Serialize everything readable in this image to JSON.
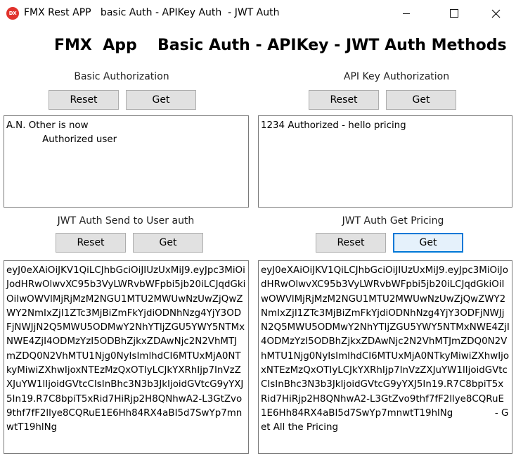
{
  "window": {
    "icon_text": "DX",
    "title": "FMX Rest APP   basic Auth - APIKey Auth  - JWT Auth"
  },
  "header": {
    "left": "FMX  App",
    "right": "Basic Auth - APIKey - JWT Auth Methods"
  },
  "basic_auth": {
    "label": "Basic Authorization",
    "reset_label": "Reset",
    "get_label": "Get",
    "memo": "A.N. Other is now\n            Authorized user"
  },
  "api_key": {
    "label": "API Key Authorization",
    "reset_label": "Reset",
    "get_label": "Get",
    "memo": "1234 Authorized - hello pricing"
  },
  "jwt_user": {
    "label": "JWT Auth Send to User auth",
    "reset_label": "Reset",
    "get_label": "Get",
    "memo": "eyJ0eXAiOiJKV1QiLCJhbGciOiJIUzUxMiJ9.eyJpc3MiOiJodHRwOlwvXC95b3VyLWRvbWFpbi5jb20iLCJqdGkiOiIwOWVlMjRjMzM2NGU1MTU2MWUwNzUwZjQwZWY2NmIxZjI1ZTc3MjBiZmFkYjdiODNhNzg4YjY3ODFjNWJjN2Q5MWU5ODMwY2NhYTljZGU5YWY5NTMxNWE4ZjI4ODMzYzI5ODBhZjkxZDAwNjc2N2VhMTJmZDQ0N2VhMTU1Njg0NyIsImlhdCI6MTUxMjA0NTkyMiwiZXhwIjoxNTEzMzQxOTIyLCJkYXRhIjp7InVzZXJuYW1lIjoidGVtcCIsInBhc3N3b3JkIjoidGVtcG9yYXJ5In19.R7C8bpiT5xRid7HiRjp2H8QNhwA2-L3GtZvo9thf7fF2llye8CQRuE1E6Hh84RX4aBI5d7SwYp7mnwtT19hlNg"
  },
  "jwt_pricing": {
    "label": "JWT Auth Get Pricing",
    "reset_label": "Reset",
    "get_label": "Get",
    "memo": "eyJ0eXAiOiJKV1QiLCJhbGciOiJIUzUxMiJ9.eyJpc3MiOiJodHRwOlwvXC95b3VyLWRvbWFpbi5jb20iLCJqdGkiOiIwOWVlMjRjMzM2NGU1MTU2MWUwNzUwZjQwZWY2NmIxZjI1ZTc3MjBiZmFkYjdiODNhNzg4YjY3ODFjNWJjN2Q5MWU5ODMwY2NhYTljZGU5YWY5NTMxNWE4ZjI4ODMzYzI5ODBhZjkxZDAwNjc2N2VhMTJmZDQ0N2VhMTU1Njg0NyIsImlhdCI6MTUxMjA0NTkyMiwiZXhwIjoxNTEzMzQxOTIyLCJkYXRhIjp7InVzZXJuYW1lIjoidGVtcCIsInBhc3N3b3JkIjoidGVtcG9yYXJ5In19.R7C8bpiT5xRid7HiRjp2H8QNhwA2-L3GtZvo9thf7fF2llye8CQRuE1E6Hh84RX4aBI5d7SwYp7mnwtT19hlNg              - Get All the Pricing"
  }
}
